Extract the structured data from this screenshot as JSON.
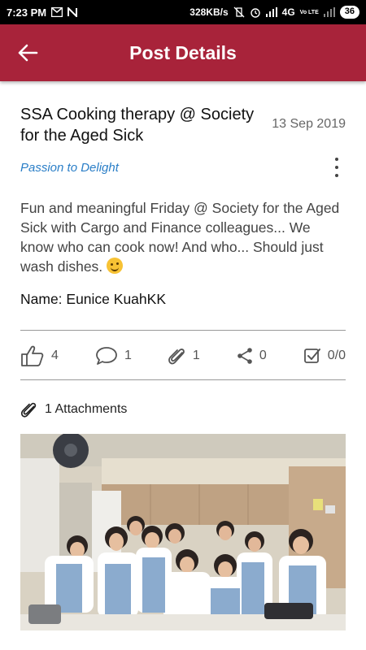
{
  "status_bar": {
    "time": "7:23 PM",
    "speed": "328KB/s",
    "network": "4G",
    "carrier_badge": "Vo LTE",
    "battery": "36"
  },
  "app_bar": {
    "title": "Post Details"
  },
  "post": {
    "title": "SSA Cooking therapy @ Society for the Aged Sick",
    "date": "13 Sep 2019",
    "category": "Passion to Delight",
    "body": "Fun and meaningful Friday @ Society for the Aged Sick with Cargo and Finance colleagues... We know who can cook now! And who... Should just wash dishes.",
    "name_line": "Name: Eunice KuahKK"
  },
  "actions": {
    "likes": "4",
    "comments": "1",
    "attachments": "1",
    "shares": "0",
    "checks": "0/0"
  },
  "attachments": {
    "label": "1 Attachments"
  },
  "colors": {
    "app_bar": "#a8233a",
    "category": "#2a7ec7"
  }
}
